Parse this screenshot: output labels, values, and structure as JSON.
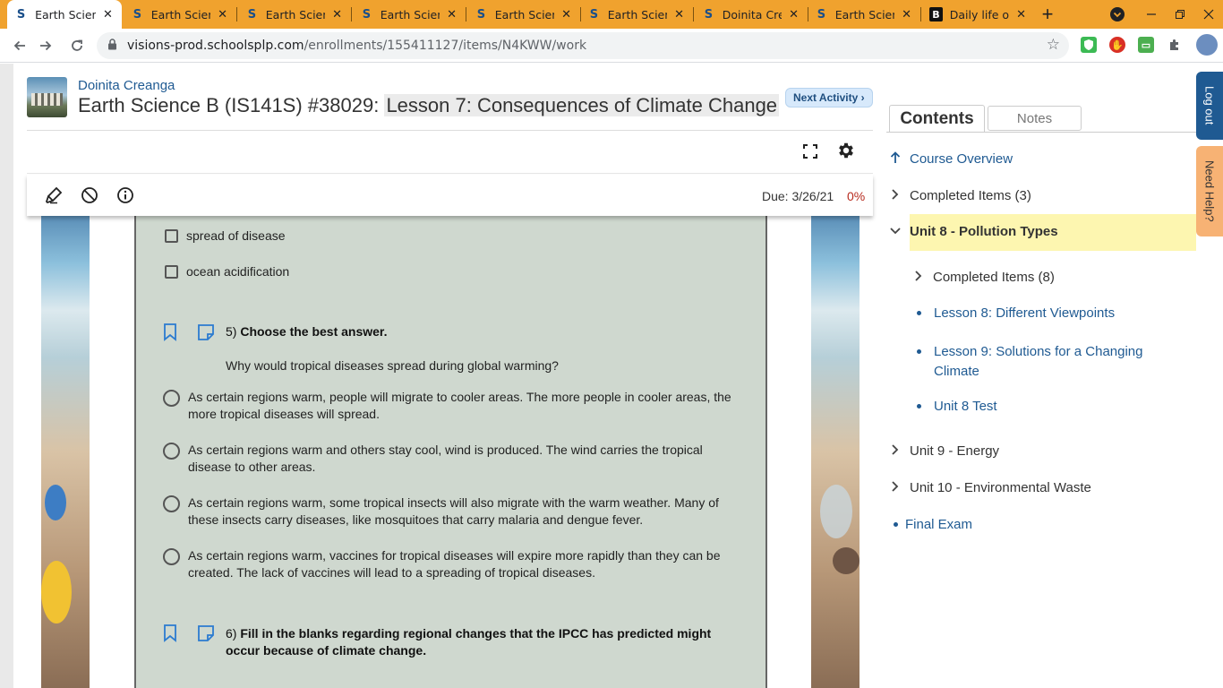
{
  "browser": {
    "tabs": [
      {
        "title": "Earth Scien",
        "favicon": "S",
        "active": true
      },
      {
        "title": "Earth Scien",
        "favicon": "S",
        "active": false
      },
      {
        "title": "Earth Scien",
        "favicon": "S",
        "active": false
      },
      {
        "title": "Earth Scien",
        "favicon": "S",
        "active": false
      },
      {
        "title": "Earth Scien",
        "favicon": "S",
        "active": false
      },
      {
        "title": "Earth Scien",
        "favicon": "S",
        "active": false
      },
      {
        "title": "Doinita Cre",
        "favicon": "S",
        "active": false
      },
      {
        "title": "Earth Scien",
        "favicon": "S",
        "active": false
      },
      {
        "title": "Daily life of",
        "favicon": "B",
        "active": false
      }
    ],
    "url_domain": "visions-prod.schoolsplp.com",
    "url_path": "/enrollments/155411127/items/N4KWW/work",
    "accent": "#f0a22e"
  },
  "header": {
    "teacher": "Doinita Creanga",
    "course": "Earth Science B (IS141S) #38029: ",
    "lesson": "Lesson 7: Consequences of Climate Change",
    "next_activity": "Next Activity ›"
  },
  "toolbar": {
    "due": "Due: 3/26/21",
    "percent": "0%"
  },
  "question_area": {
    "checkbox_options": [
      "spread of disease",
      "ocean acidification"
    ],
    "q5": {
      "number": "5)",
      "instruction": "Choose the best answer.",
      "prompt": "Why would tropical diseases spread during global warming?",
      "options": [
        "As certain regions warm, people will migrate to cooler areas. The more people in cooler areas, the more tropical diseases will spread.",
        "As certain regions warm and others stay cool, wind is produced. The wind carries the tropical disease to other areas.",
        "As certain regions warm, some tropical insects will also migrate with the warm weather. Many of these insects carry diseases, like mosquitoes that carry malaria and dengue fever.",
        "As certain regions warm, vaccines for tropical diseases will expire more rapidly than they can be created. The lack of vaccines will lead to a spreading of tropical diseases."
      ]
    },
    "q6": {
      "number": "6)",
      "instruction": "Fill in the blanks regarding regional changes that the IPCC has predicted might occur because of climate change."
    }
  },
  "sidebar": {
    "tab_contents": "Contents",
    "tab_notes": "Notes",
    "items": [
      {
        "label": "Course Overview"
      },
      {
        "label": "Completed Items (3)"
      },
      {
        "label": "Unit 8 - Pollution Types"
      },
      {
        "label": "Completed Items (8)"
      },
      {
        "label": "Lesson 8: Different Viewpoints"
      },
      {
        "label": "Lesson 9: Solutions for a Changing Climate"
      },
      {
        "label": "Unit 8 Test"
      },
      {
        "label": "Unit 9 - Energy"
      },
      {
        "label": "Unit 10 - Environmental Waste"
      },
      {
        "label": "Final Exam"
      }
    ]
  },
  "sidetabs": {
    "logout": "Log out",
    "help": "Need Help?"
  }
}
